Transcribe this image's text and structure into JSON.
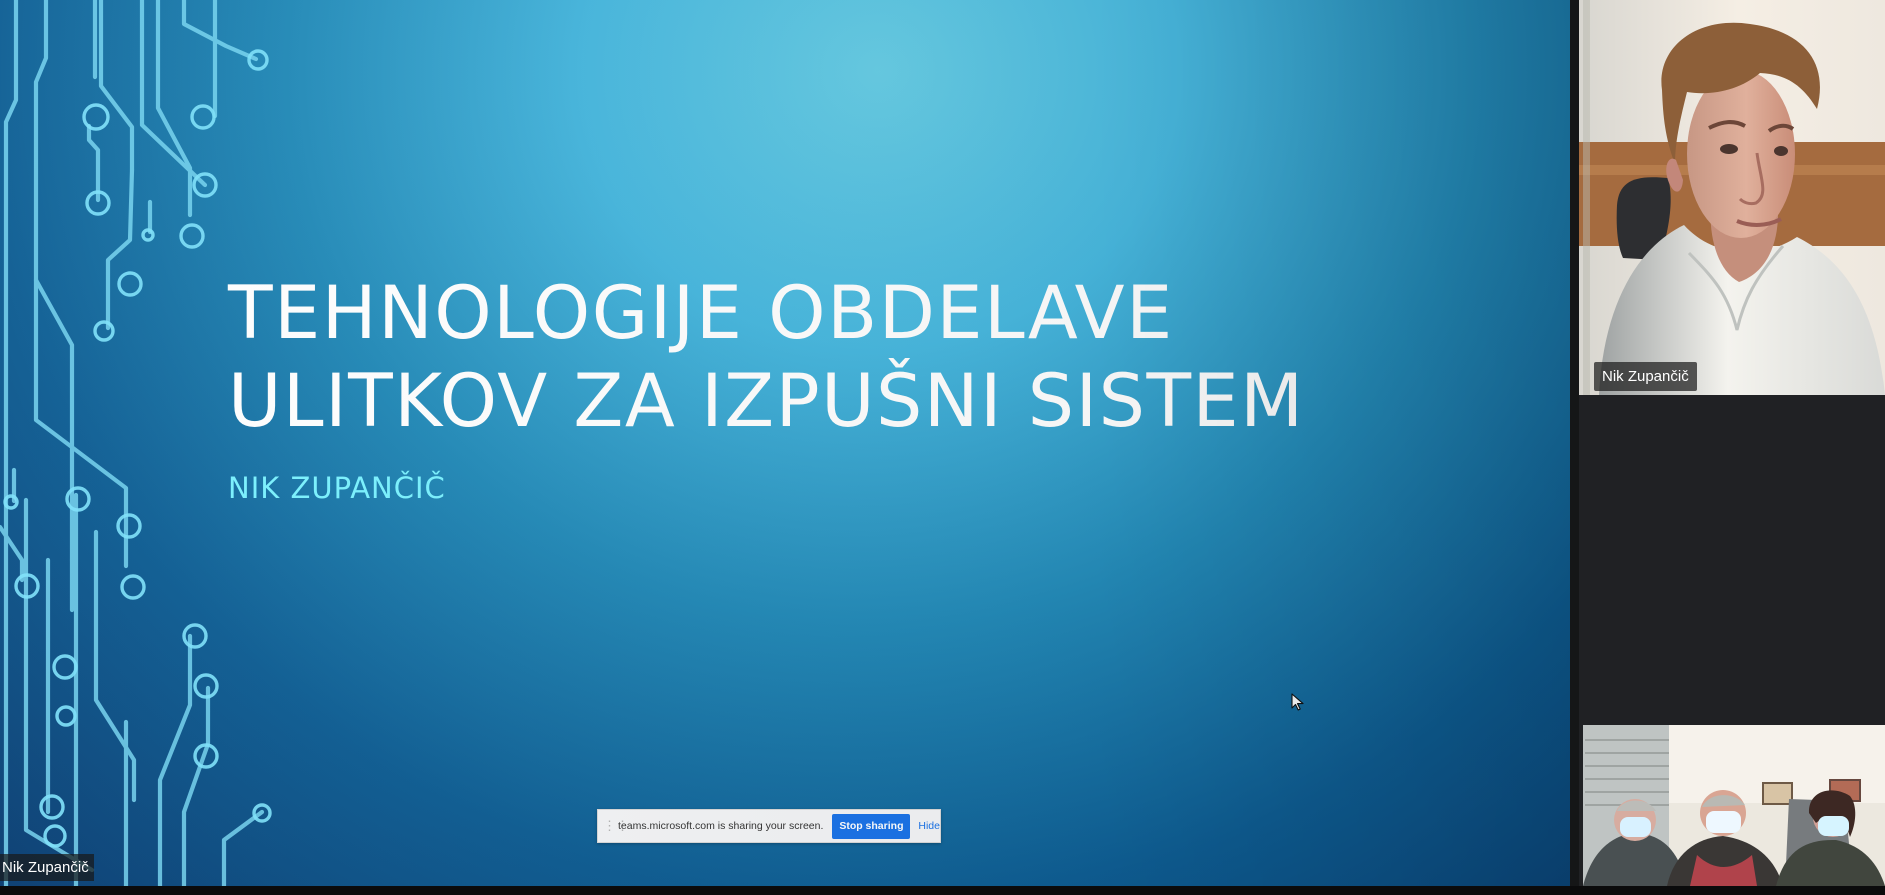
{
  "slide": {
    "title_line_1": "TEHNOLOGIJE OBDELAVE",
    "title_line_2": "ULITKOV ZA IZPUŠNI SISTEM",
    "subtitle": "NIK ZUPANČIČ",
    "presenter_label": "Nik Zupančič"
  },
  "screen_share": {
    "message": "teams.microsoft.com is sharing your screen.",
    "stop_label": "Stop sharing",
    "hide_label": "Hide"
  },
  "participants": {
    "main": {
      "name": "Nik Zupančič"
    }
  },
  "colors": {
    "slide_deep_blue": "#083b70",
    "slide_cyan": "#67cde5",
    "subtitle_cyan": "#7bf2ff",
    "share_button_blue": "#1a73e8",
    "panel_background": "#202124"
  },
  "icons": {
    "pointer": "cursor-icon",
    "drag_handle": "drag-handle-icon"
  }
}
